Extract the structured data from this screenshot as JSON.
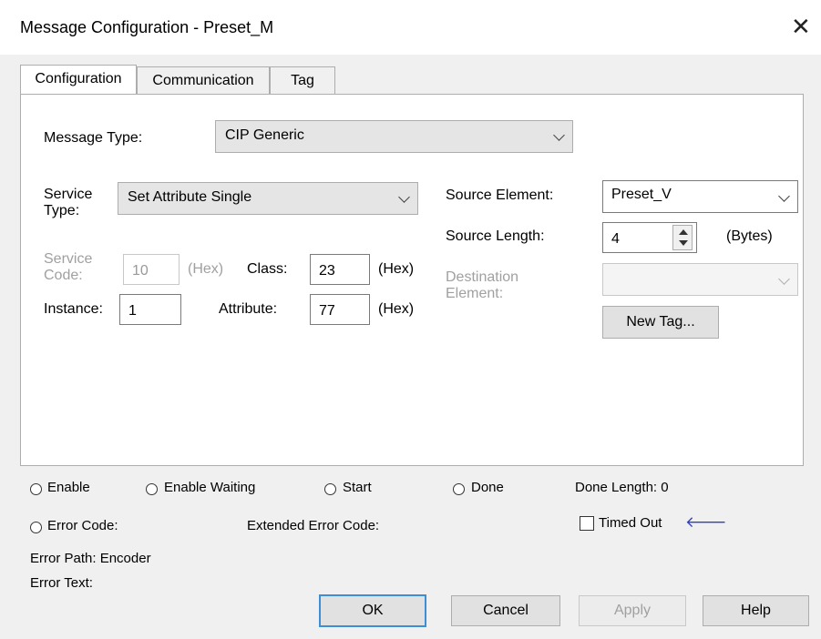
{
  "window": {
    "title": "Message Configuration - Preset_M",
    "close_glyph": "✕"
  },
  "tabs": [
    {
      "label": "Configuration",
      "active": true
    },
    {
      "label": "Communication",
      "active": false
    },
    {
      "label": "Tag",
      "active": false
    }
  ],
  "config": {
    "message_type_label": "Message Type:",
    "message_type_value": "CIP Generic",
    "service_type_label_1": "Service",
    "service_type_label_2": "Type:",
    "service_type_value": "Set Attribute Single",
    "service_code_label_1": "Service",
    "service_code_label_2": "Code:",
    "service_code_value": "10",
    "hex_label": "(Hex)",
    "class_label": "Class:",
    "class_value": "23",
    "instance_label": "Instance:",
    "instance_value": "1",
    "attribute_label": "Attribute:",
    "attribute_value": "77",
    "source_element_label": "Source Element:",
    "source_element_value": "Preset_V",
    "source_length_label": "Source Length:",
    "source_length_value": "4",
    "bytes_label": "(Bytes)",
    "destination_element_label_1": "Destination",
    "destination_element_label_2": "Element:",
    "destination_element_value": "",
    "new_tag_label": "New Tag..."
  },
  "status": {
    "enable": "Enable",
    "enable_waiting": "Enable Waiting",
    "start": "Start",
    "done": "Done",
    "done_length": "Done Length: 0",
    "error_code": "Error Code:",
    "extended_error_code": "Extended Error Code:",
    "timed_out": "Timed Out",
    "error_path": "Error Path: Encoder",
    "error_text": "Error Text:"
  },
  "buttons": {
    "ok": "OK",
    "cancel": "Cancel",
    "apply": "Apply",
    "help": "Help"
  },
  "colors": {
    "accent": "#3c8fd6",
    "arrow": "#2a3bd6"
  }
}
